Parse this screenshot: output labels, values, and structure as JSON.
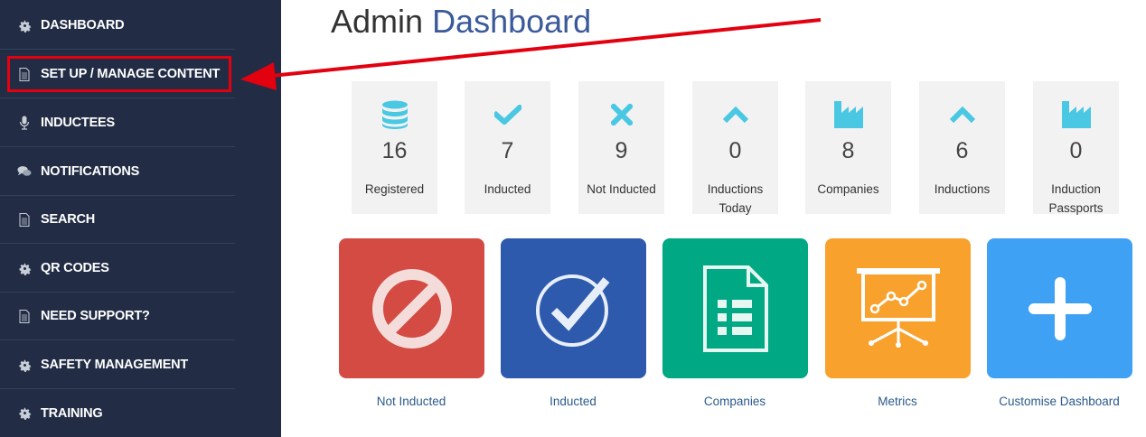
{
  "sidebar": {
    "items": [
      {
        "label": "DASHBOARD",
        "icon": "gear-icon"
      },
      {
        "label": "SET UP / MANAGE CONTENT",
        "icon": "document-icon"
      },
      {
        "label": "INDUCTEES",
        "icon": "microphone-icon"
      },
      {
        "label": "NOTIFICATIONS",
        "icon": "chat-icon"
      },
      {
        "label": "SEARCH",
        "icon": "document-icon"
      },
      {
        "label": "QR CODES",
        "icon": "gear-icon"
      },
      {
        "label": "NEED SUPPORT?",
        "icon": "document-icon"
      },
      {
        "label": "SAFETY MANAGEMENT",
        "icon": "gear-icon"
      },
      {
        "label": "TRAINING",
        "icon": "gear-icon"
      }
    ]
  },
  "header": {
    "title_part1": "Admin",
    "title_part2": "Dashboard"
  },
  "stats": [
    {
      "icon": "database-icon",
      "value": "16",
      "label": "Registered"
    },
    {
      "icon": "check-icon",
      "value": "7",
      "label": "Inducted"
    },
    {
      "icon": "x-icon",
      "value": "9",
      "label": "Not Inducted"
    },
    {
      "icon": "chevron-up-icon",
      "value": "0",
      "label": "Inductions Today"
    },
    {
      "icon": "factory-icon",
      "value": "8",
      "label": "Companies"
    },
    {
      "icon": "chevron-up-icon",
      "value": "6",
      "label": "Inductions"
    },
    {
      "icon": "factory-icon",
      "value": "0",
      "label": "Induction Passports"
    }
  ],
  "tiles": [
    {
      "icon": "prohibited-icon",
      "label": "Not Inducted",
      "color": "#d34b43"
    },
    {
      "icon": "check-circle-icon",
      "label": "Inducted",
      "color": "#2d5aad"
    },
    {
      "icon": "document-list-icon",
      "label": "Companies",
      "color": "#00a884"
    },
    {
      "icon": "presentation-chart-icon",
      "label": "Metrics",
      "color": "#f9a12d"
    },
    {
      "icon": "plus-icon",
      "label": "Customise Dashboard",
      "color": "#3ea1f4"
    }
  ],
  "colors": {
    "sidebar_bg": "#222d45",
    "accent": "#3b5a9a",
    "stat_icon": "#4ac8e3",
    "annotation": "#e3000f"
  }
}
